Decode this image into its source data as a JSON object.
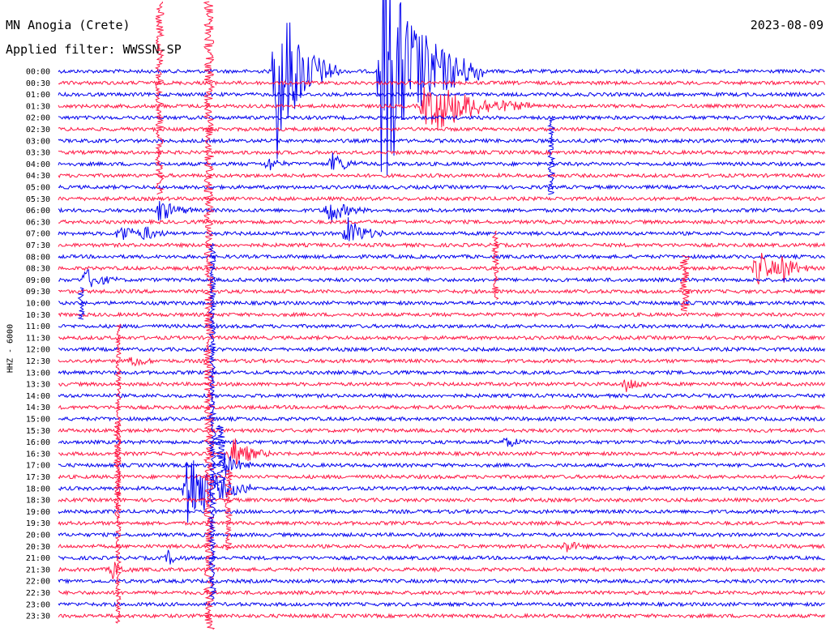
{
  "header": {
    "station": "MN Anogia (Crete)",
    "date": "2023-08-09",
    "filter": "Applied filter: WWSSN-SP",
    "channel": "HHZ - 6000"
  },
  "colors": {
    "odd": "#0000ee",
    "even": "#ff1744",
    "text": "#000000"
  },
  "chart_data": {
    "type": "helicorder",
    "title": "MN Anogia (Crete)",
    "date": "2023-08-09",
    "ylabel": "HHZ - 6000",
    "row_minutes": 30,
    "row_labels": [
      "00:00",
      "00:30",
      "01:00",
      "01:30",
      "02:00",
      "02:30",
      "03:00",
      "03:30",
      "04:00",
      "04:30",
      "05:00",
      "05:30",
      "06:00",
      "06:30",
      "07:00",
      "07:30",
      "08:00",
      "08:30",
      "09:00",
      "09:30",
      "10:00",
      "10:30",
      "11:00",
      "11:30",
      "12:00",
      "12:30",
      "13:00",
      "13:30",
      "14:00",
      "14:30",
      "15:00",
      "15:30",
      "16:00",
      "16:30",
      "17:00",
      "17:30",
      "18:00",
      "18:30",
      "19:00",
      "19:30",
      "20:00",
      "20:30",
      "21:00",
      "21:30",
      "22:00",
      "22:30",
      "23:00",
      "23:30"
    ],
    "events": [
      {
        "row": 0,
        "minute": 8.5,
        "amplitude": 9,
        "duration_min": 2.5
      },
      {
        "row": 0,
        "minute": 12.6,
        "amplitude": 12,
        "duration_min": 4
      },
      {
        "row": 3,
        "minute": 14.7,
        "amplitude": 2.5,
        "duration_min": 4
      },
      {
        "row": 3,
        "minute": 14.3,
        "amplitude": 2.2,
        "duration_min": 3
      },
      {
        "row": 8,
        "minute": 8.2,
        "amplitude": 0.8,
        "duration_min": 0.8
      },
      {
        "row": 8,
        "minute": 10.7,
        "amplitude": 1.2,
        "duration_min": 1.2
      },
      {
        "row": 12,
        "minute": 3.9,
        "amplitude": 1.2,
        "duration_min": 1.5
      },
      {
        "row": 12,
        "minute": 10.5,
        "amplitude": 1.5,
        "duration_min": 1.5
      },
      {
        "row": 14,
        "minute": 2.4,
        "amplitude": 1.1,
        "duration_min": 1.2
      },
      {
        "row": 14,
        "minute": 3.3,
        "amplitude": 0.9,
        "duration_min": 1.0
      },
      {
        "row": 14,
        "minute": 11.3,
        "amplitude": 1.6,
        "duration_min": 1.5
      },
      {
        "row": 17,
        "minute": 27.3,
        "amplitude": 2.0,
        "duration_min": 1.5
      },
      {
        "row": 17,
        "minute": 28.3,
        "amplitude": 1.5,
        "duration_min": 1.2
      },
      {
        "row": 18,
        "minute": 1.0,
        "amplitude": 1.2,
        "duration_min": 1.4
      },
      {
        "row": 25,
        "minute": 2.9,
        "amplitude": 0.8,
        "duration_min": 0.8
      },
      {
        "row": 27,
        "minute": 22.2,
        "amplitude": 0.9,
        "duration_min": 1.0
      },
      {
        "row": 32,
        "minute": 17.5,
        "amplitude": 0.7,
        "duration_min": 0.8
      },
      {
        "row": 33,
        "minute": 6.8,
        "amplitude": 1.8,
        "duration_min": 1.5
      },
      {
        "row": 34,
        "minute": 6.5,
        "amplitude": 1.2,
        "duration_min": 1.2
      },
      {
        "row": 36,
        "minute": 5.0,
        "amplitude": 4.5,
        "duration_min": 2.5
      },
      {
        "row": 41,
        "minute": 19.8,
        "amplitude": 0.8,
        "duration_min": 0.9
      },
      {
        "row": 42,
        "minute": 4.3,
        "amplitude": 0.7,
        "duration_min": 0.7
      },
      {
        "row": 43,
        "minute": 2.1,
        "amplitude": 1.0,
        "duration_min": 0.8
      }
    ]
  }
}
